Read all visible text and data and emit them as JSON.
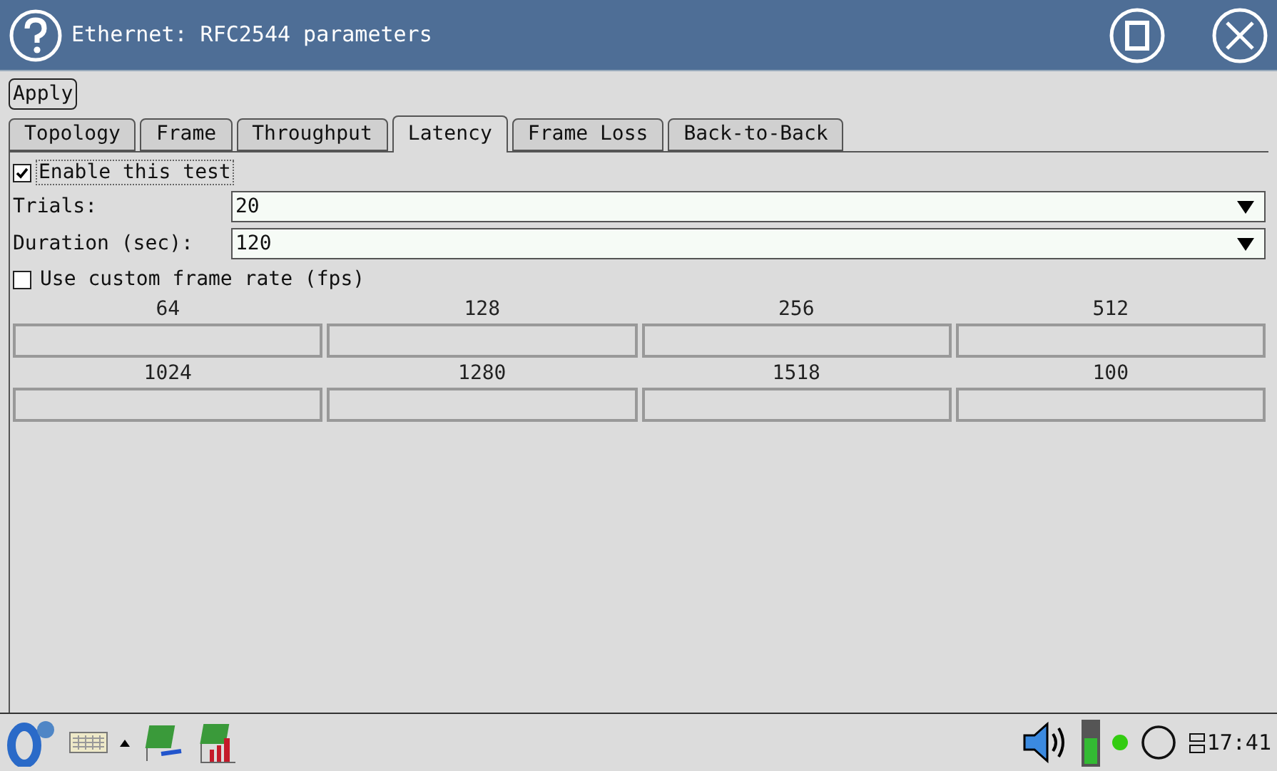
{
  "window": {
    "title": "Ethernet: RFC2544 parameters"
  },
  "toolbar": {
    "apply": "Apply"
  },
  "tabs": [
    {
      "label": "Topology",
      "selected": false
    },
    {
      "label": "Frame",
      "selected": false
    },
    {
      "label": "Throughput",
      "selected": false
    },
    {
      "label": "Latency",
      "selected": true
    },
    {
      "label": "Frame Loss",
      "selected": false
    },
    {
      "label": "Back-to-Back",
      "selected": false
    }
  ],
  "enable_test": {
    "label": "Enable this test",
    "checked": true
  },
  "fields": [
    {
      "label": "Trials:",
      "value": "20"
    },
    {
      "label": "Duration (sec):",
      "value": "120"
    }
  ],
  "custom_rate": {
    "label": "Use custom frame rate (fps)",
    "checked": false
  },
  "frame_sizes": [
    {
      "label": "64"
    },
    {
      "label": "128"
    },
    {
      "label": "256"
    },
    {
      "label": "512"
    },
    {
      "label": "1024"
    },
    {
      "label": "1280"
    },
    {
      "label": "1518"
    },
    {
      "label": "100"
    }
  ],
  "taskbar": {
    "battery": {
      "level": 0.6
    },
    "clock": "17:41"
  }
}
